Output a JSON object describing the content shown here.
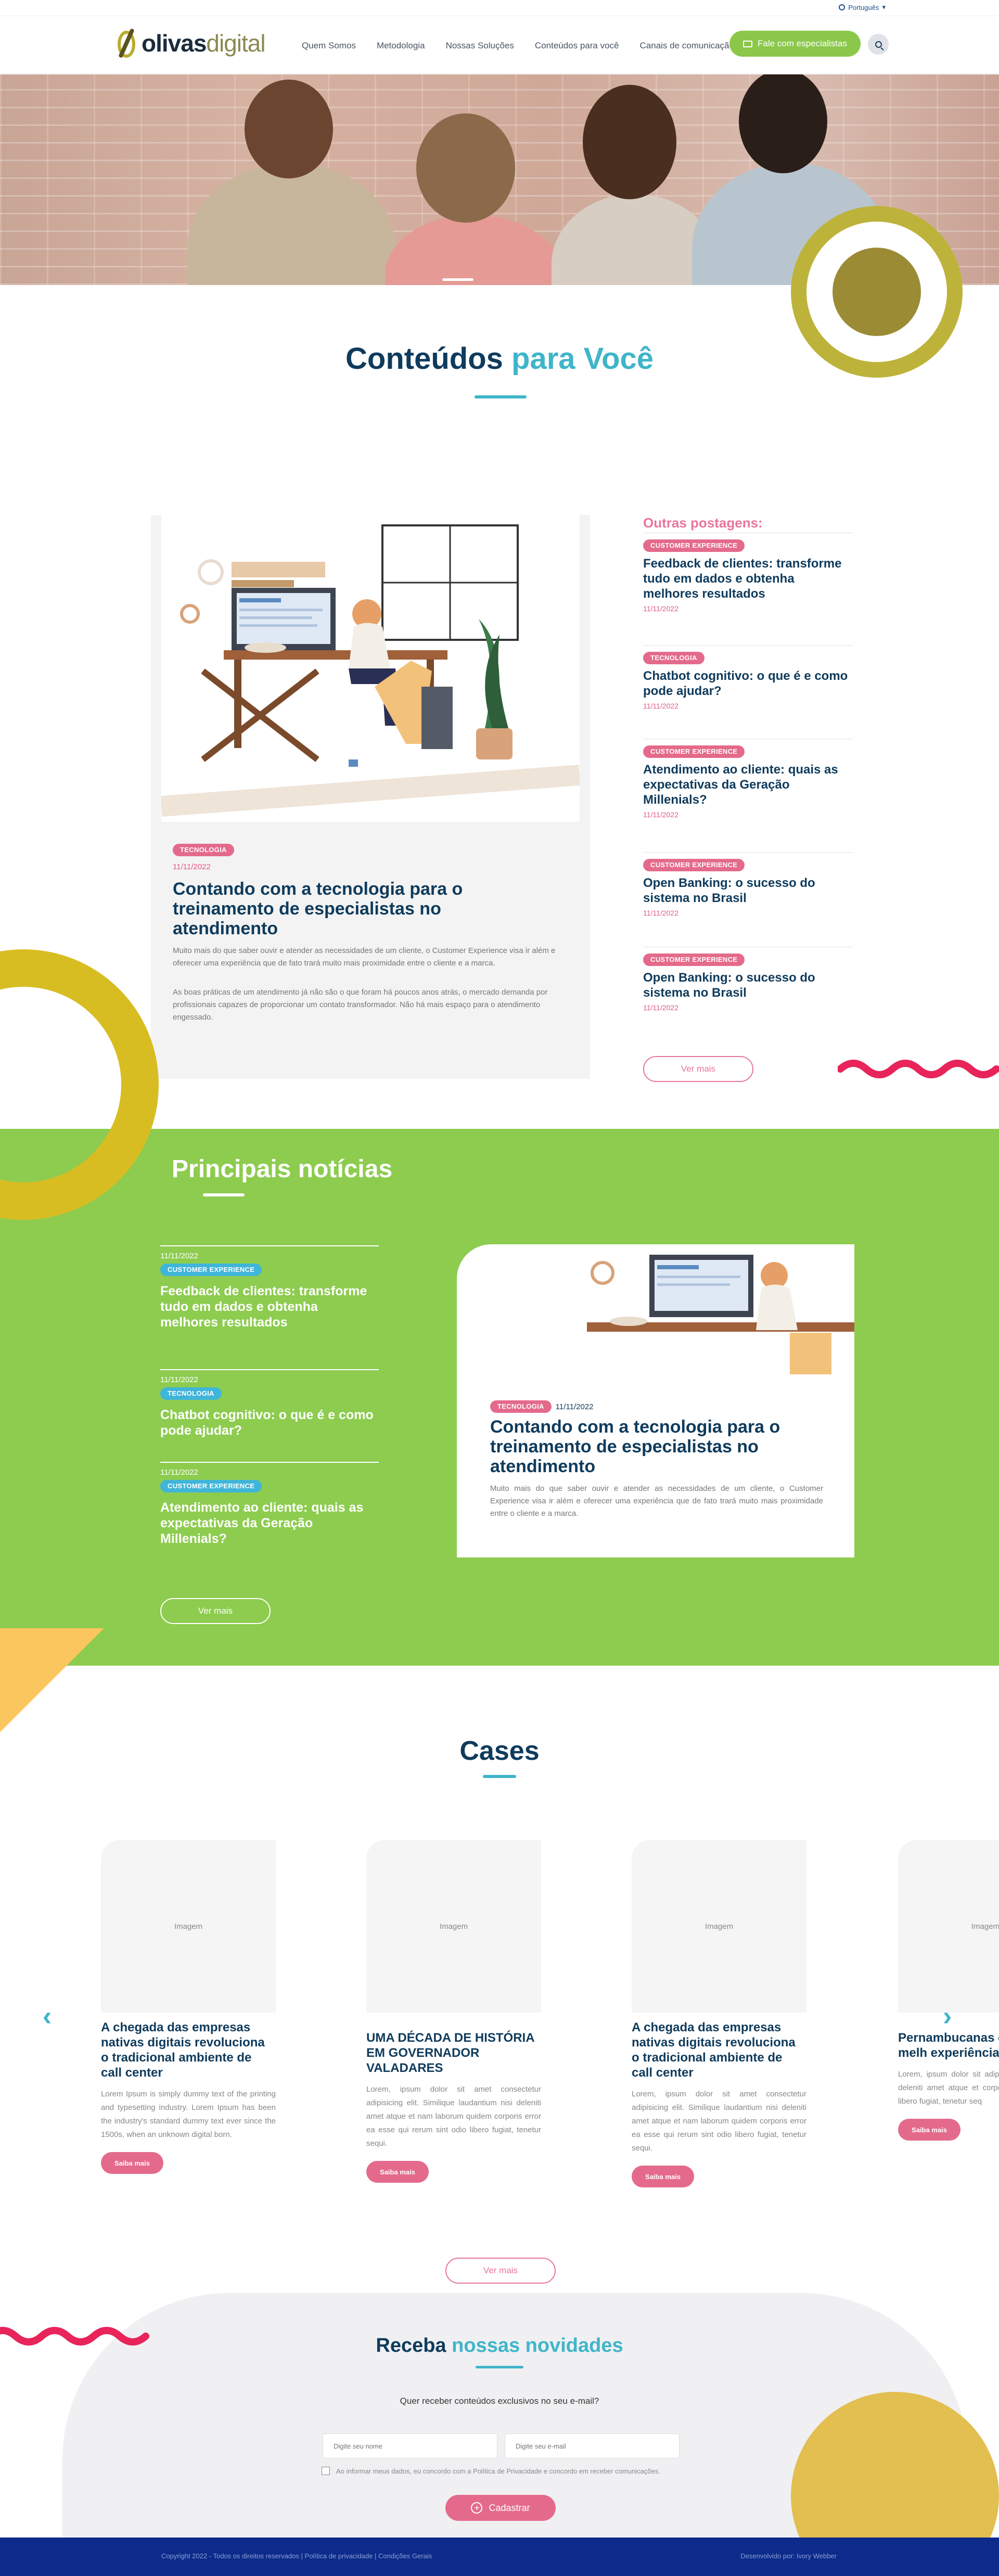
{
  "lang": {
    "label": "Português",
    "chevron": "chevron-down-icon"
  },
  "brand": {
    "bold": "olivas",
    "light": "digital"
  },
  "nav": {
    "items": [
      "Quem Somos",
      "Metodologia",
      "Nossas Soluções",
      "Conteúdos para você",
      "Canais de comunicação"
    ]
  },
  "cta": {
    "label": "Fale com especialistas"
  },
  "conteudos": {
    "title_main": "Conteúdos",
    "title_accent": "para Você"
  },
  "feature": {
    "tag": "TECNOLOGIA",
    "date": "11/11/2022",
    "title": "Contando com a tecnologia para o treinamento de especialistas no atendimento",
    "p1": "Muito mais do que saber ouvir e atender as necessidades de um cliente, o Customer Experience visa ir além e oferecer uma experiência que de fato trará muito mais proximidade entre o cliente e a marca.",
    "p2": "As boas práticas de um atendimento já não são o que foram há poucos anos atrás, o mercado demanda por profissionais capazes de proporcionar um contato transformador. Não há mais espaço para o atendimento engessado."
  },
  "sidebar": {
    "title": "Outras postagens:",
    "posts": [
      {
        "tag": "CUSTOMER EXPERIENCE",
        "title": "Feedback de clientes: transforme tudo em dados e obtenha melhores resultados",
        "date": "11/11/2022"
      },
      {
        "tag": "TECNOLOGIA",
        "title": "Chatbot cognitivo: o que é e como pode ajudar?",
        "date": "11/11/2022"
      },
      {
        "tag": "CUSTOMER EXPERIENCE",
        "title": "Atendimento ao cliente: quais as expectativas da Geração Millenials?",
        "date": "11/11/2022"
      },
      {
        "tag": "CUSTOMER EXPERIENCE",
        "title": "Open Banking: o sucesso do sistema no Brasil",
        "date": "11/11/2022"
      },
      {
        "tag": "CUSTOMER EXPERIENCE",
        "title": "Open Banking: o sucesso do sistema no Brasil",
        "date": "11/11/2022"
      }
    ],
    "more": "Ver mais"
  },
  "noticias": {
    "title": "Principais notícias",
    "items": [
      {
        "date": "11/11/2022",
        "tag": "CUSTOMER EXPERIENCE",
        "title": "Feedback de clientes: transforme tudo em dados e obtenha melhores resultados"
      },
      {
        "date": "11/11/2022",
        "tag": "TECNOLOGIA",
        "title": "Chatbot cognitivo: o que é e como pode ajudar?"
      },
      {
        "date": "11/11/2022",
        "tag": "CUSTOMER EXPERIENCE",
        "title": "Atendimento ao cliente: quais as expectativas da Geração Millenials?"
      }
    ],
    "more": "Ver mais",
    "card": {
      "tag": "TECNOLOGIA",
      "date": "11/11/2022",
      "title": "Contando com a tecnologia para o treinamento de especialistas no atendimento",
      "body": "Muito mais do que saber ouvir e atender as necessidades de um cliente, o Customer Experience visa ir além e oferecer uma experiência que de fato trará muito mais proximidade entre o cliente e a marca."
    }
  },
  "cases": {
    "title": "Cases",
    "items": [
      {
        "img_alt": "Imagem",
        "title": "A chegada das empresas nativas digitais revoluciona o tradicional ambiente de call center",
        "body": "Lorem Ipsum is simply dummy text of the printing and typesetting industry. Lorem Ipsum has been the industry's standard dummy text ever since the 1500s, when an unknown digital born.",
        "btn": "Saiba mais"
      },
      {
        "img_alt": "Imagem",
        "title": "UMA DÉCADA DE HISTÓRIA EM GOVERNADOR VALADARES",
        "body": "Lorem, ipsum dolor sit amet consectetur adipisicing elit. Similique laudantium nisi deleniti amet atque et nam laborum quidem corporis error ea esse qui rerum sint odio libero fugiat, tenetur sequi.",
        "btn": "Saiba mais"
      },
      {
        "img_alt": "Imagem",
        "title": "A chegada das empresas nativas digitais revoluciona o tradicional ambiente de call center",
        "body": "Lorem, ipsum dolor sit amet consectetur adipisicing elit. Similique laudantium nisi deleniti amet atque et nam laborum quidem corporis error ea esse qui rerum sint odio libero fugiat, tenetur sequi.",
        "btn": "Saiba mais"
      },
      {
        "img_alt": "Imagem",
        "title": "Pernambucanas operação e melh experiência do c",
        "body": "Lorem, ipsum dolor sit adipisicing elit. Similique deleniti amet atque et corporis error ea esse q libero fugiat, tenetur seq",
        "btn": "Saiba mais"
      }
    ],
    "more": "Ver mais",
    "prev": "‹",
    "next": "›"
  },
  "newsletter": {
    "title_main": "Receba",
    "title_accent": "nossas novidades",
    "subtitle": "Quer receber conteúdos exclusivos no seu e-mail?",
    "name_placeholder": "Digite seu nome",
    "email_placeholder": "Digite seu e-mail",
    "consent": "Ao informar meus dados, eu concordo com a Política de Privacidade e concordo em receber comunicações.",
    "submit": "Cadastrar"
  },
  "footer": {
    "left": "Copyright 2022 - Todos os direitos reservados | Política de privacidade | Condições Gerais",
    "right": "Desenvolvido por: Ivory Webber"
  },
  "colors": {
    "green": "#8dcc4f",
    "pink": "#e46a8c",
    "cyan": "#3fb5c9",
    "navy": "#0f3b5c",
    "yellow": "#d8bd22",
    "footer": "#0d2b8a"
  }
}
